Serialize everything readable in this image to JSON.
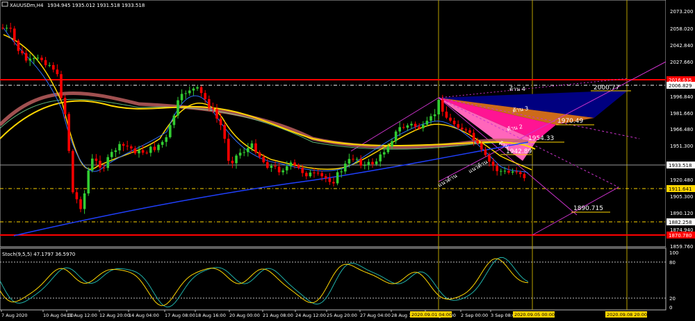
{
  "window": {
    "title": "XAUUSDm,H4",
    "ohlc": "1934.945 1935.012 1931.518 1933.518",
    "symbol_icon": "chart-icon"
  },
  "price_axis": {
    "labels": [
      "2073.200",
      "2058.020",
      "2042.840",
      "2027.660",
      "2006.829",
      "1996.840",
      "1981.660",
      "1966.480",
      "1951.300",
      "1933.518",
      "1920.480",
      "1905.300",
      "1890.120",
      "1874.940",
      "1859.760"
    ],
    "badges": [
      {
        "text": "2016.635",
        "color": "#ff0000",
        "text_color": "#ffffff"
      },
      {
        "text": "2006.829",
        "color": "#ffffff",
        "text_color": "#000000"
      },
      {
        "text": "1933.518",
        "color": "#ffffff",
        "text_color": "#000000"
      },
      {
        "text": "1911.641",
        "color": "#ffd700",
        "text_color": "#000000"
      },
      {
        "text": "1882.258",
        "color": "#ffffff",
        "text_color": "#000000"
      },
      {
        "text": "1870.780",
        "color": "#ff0000",
        "text_color": "#ffffff"
      }
    ]
  },
  "annotations": {
    "resist4": "ต้าน 4",
    "resist3": "ต้าน 3",
    "resist2": "ต้าน 2",
    "resist1": "ต้าน",
    "support1": "แนวต้าน",
    "support2": "แนวต้าน",
    "level_2000": "2000.77",
    "level_1970": "1970.49",
    "level_1954": "1954.33",
    "level_1942": "1942.89",
    "level_1890": "1890.715"
  },
  "stoch": {
    "title": "Stoch(9,5,5) 47.1797 36.5970",
    "levels": [
      "100",
      "80",
      "20",
      "0"
    ]
  },
  "time_axis": {
    "labels": [
      "7 Aug 2020",
      "10 Aug 04:00",
      "11 Aug 12:00",
      "12 Aug 20:00",
      "14 Aug 04:00",
      "17 Aug 08:00",
      "18 Aug 16:00",
      "20 Aug 00:00",
      "21 Aug 08:00",
      "24 Aug 12:00",
      "25 Aug 20:00",
      "27 Aug 04:00",
      "28 Aug 12:00",
      "31 Aug 20:00",
      "2 Sep 00:00",
      "3 Sep 08:00"
    ],
    "badges": [
      {
        "text": "2020.09.01 04:00",
        "color": "#ffd700"
      },
      {
        "text": "2020.09.05 00:00",
        "color": "#ffd700"
      },
      {
        "text": "2020.09.08 20:00",
        "color": "#ffd700"
      }
    ]
  },
  "colors": {
    "bull": "#32cd32",
    "bear": "#ff0000",
    "ma_blue": "#2040ff",
    "ma_yellow": "#ffd700",
    "ma_band": "#c86464",
    "grid": "#ffffff",
    "fib_magenta": "#cc33cc",
    "navy": "#000080",
    "orange": "#d2691e",
    "pink": "#ff1493"
  }
}
